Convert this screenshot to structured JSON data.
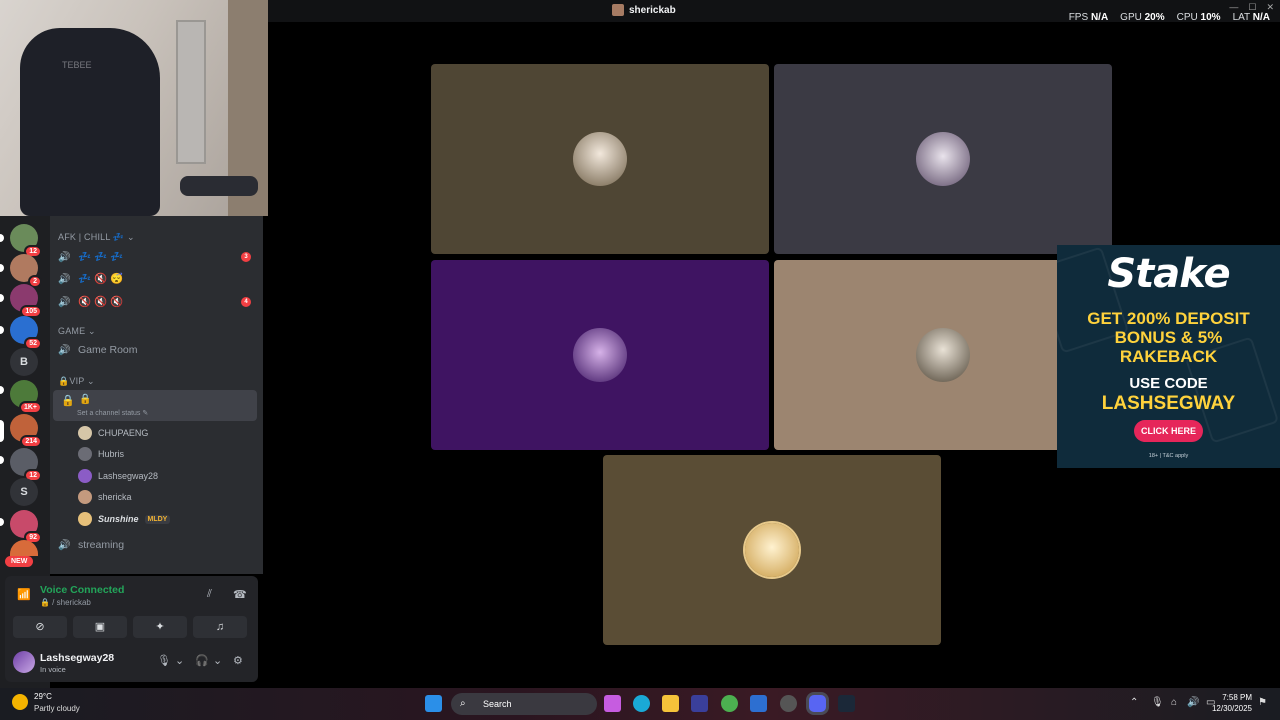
{
  "topbar": {
    "title": "sherickab",
    "perf": [
      {
        "label": "FPS",
        "value": "N/A"
      },
      {
        "label": "GPU",
        "value": "20%"
      },
      {
        "label": "CPU",
        "value": "10%"
      },
      {
        "label": "LAT",
        "value": "N/A"
      }
    ]
  },
  "rail": {
    "servers": [
      {
        "badge": "12",
        "color": "#6a8b5a"
      },
      {
        "badge": "2",
        "color": "#b07a60"
      },
      {
        "badge": "105",
        "color": "#8b3a6e"
      },
      {
        "badge": "52",
        "color": "#2a6fd1"
      },
      {
        "letter": "B",
        "color": "#313338"
      },
      {
        "badge": "1K+",
        "color": "#4d7a3a"
      },
      {
        "badge": "214",
        "color": "#c0623a"
      },
      {
        "badge": "12",
        "color": "#5a5d66"
      },
      {
        "letter": "S",
        "color": "#313338"
      },
      {
        "badge": "92",
        "color": "#c84a6a"
      },
      {
        "badge": "",
        "color": "#d86b3a"
      }
    ],
    "new_label": "NEW"
  },
  "channels": {
    "cat_afk": "AFK | CHILL 💤",
    "afk_channels": [
      {
        "name": "💤 💤 💤",
        "badge": "3"
      },
      {
        "name": "💤 🔇 😴",
        "badge": ""
      },
      {
        "name": "🔇 🔇 🔇",
        "badge": "4"
      }
    ],
    "cat_game": "GAME",
    "game_room": "Game Room",
    "cat_vip": "🔒VIP",
    "vip_channel": "🔒",
    "status_hint": "Set a channel status ✎",
    "members": [
      {
        "name": "CHUPAENG",
        "color": "#d6c6a8",
        "bold": false
      },
      {
        "name": "Hubris",
        "color": "#6b6c75",
        "bold": false
      },
      {
        "name": "Lashsegway28",
        "color": "#8b5cc6",
        "bold": false
      },
      {
        "name": "shericka",
        "color": "#c49a7e",
        "bold": false
      },
      {
        "name": "Sunshine",
        "color": "#e6c07a",
        "bold": true,
        "tag": "MLDY"
      }
    ],
    "streaming": "streaming"
  },
  "voice": {
    "title": "Voice Connected",
    "sub": "🔒 / sherickab",
    "user": "Lashsegway28",
    "state": "In voice"
  },
  "stage": {
    "tiles": [
      {
        "bg": "#4f4634",
        "av": "#c8b9a4"
      },
      {
        "bg": "#3b3a44",
        "av": "#7b6882"
      },
      {
        "bg": "#3f1462",
        "av": "#a97ac7"
      },
      {
        "bg": "#9c8570",
        "av": "#8a8f7a"
      },
      {
        "bg": "#5a4d35",
        "av": "#e7c98b"
      }
    ]
  },
  "ad": {
    "logo": "Stake",
    "line1": "GET 200% DEPOSIT BONUS & 5% RAKEBACK",
    "line2": "USE CODE",
    "line3": "LASHSEGWAY",
    "cta": "CLICK HERE",
    "fine": "18+ | T&C apply"
  },
  "taskbar": {
    "temp": "29°C",
    "condition": "Partly cloudy",
    "search": "Search",
    "time": "7:58 PM",
    "date": "12/30/2025"
  }
}
